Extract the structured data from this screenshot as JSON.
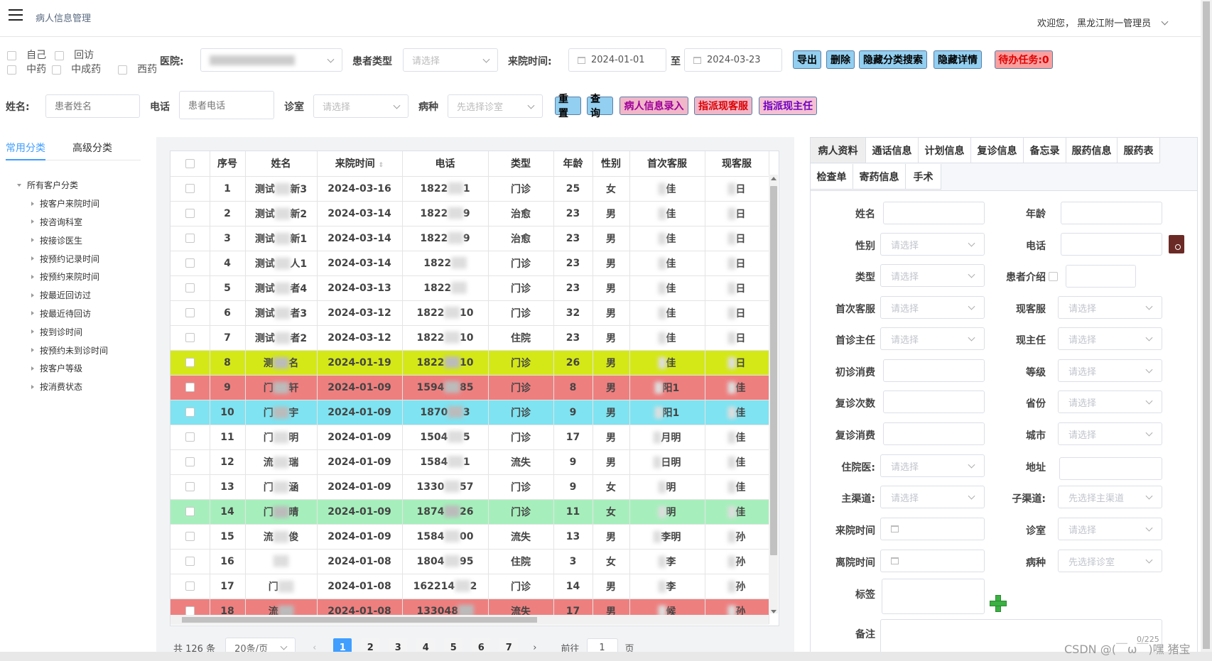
{
  "app": {
    "title": "病人信息管理",
    "welcome": "欢迎您， 黑龙江附一管理员"
  },
  "filters": {
    "checks": [
      "自己",
      "回访",
      "中药",
      "中成药",
      "西药"
    ],
    "hospital_label": "医院:",
    "patient_type_label": "患者类型",
    "patient_type_placeholder": "请选择",
    "visit_time_label": "来院时间:",
    "date_from": "2024-01-01",
    "date_to": "2024-03-23",
    "to_label": "至",
    "name_label": "姓名:",
    "name_placeholder": "患者姓名",
    "phone_label": "电话",
    "phone_placeholder": "患者电话",
    "room_label": "诊室",
    "room_placeholder": "请选择",
    "disease_label": "病种",
    "disease_placeholder": "先选择诊室"
  },
  "buttons": {
    "export": "导出",
    "delete": "删除",
    "hide_search": "隐藏分类搜索",
    "hide_detail": "隐藏详情",
    "todo": "待办任务:0",
    "reset": "重置",
    "query": "查询",
    "entry": "病人信息录入",
    "assign_service": "指派现客服",
    "assign_doctor": "指派现主任"
  },
  "sidebar": {
    "tab_common": "常用分类",
    "tab_advanced": "高级分类",
    "root": "所有客户分类",
    "items": [
      "按客户来院时间",
      "按咨询科室",
      "按接诊医生",
      "按预约记录时间",
      "按预约来院时间",
      "按最近回访过",
      "按最近待回访",
      "按到诊时间",
      "按预约未到诊时间",
      "按客户等级",
      "按消费状态"
    ]
  },
  "table": {
    "headers": [
      "序号",
      "姓名",
      "来院时间",
      "电话",
      "类型",
      "年龄",
      "性别",
      "首次客服",
      "现客服"
    ],
    "rows": [
      {
        "no": "1",
        "name": "测试",
        "name_m": "新3",
        "date": "2024-03-16",
        "phone": "1822",
        "phone_m": "1",
        "type": "门诊",
        "age": "25",
        "sex": "女",
        "first": "佳",
        "cur": "日",
        "color": ""
      },
      {
        "no": "2",
        "name": "测试",
        "name_m": "新2",
        "date": "2024-03-14",
        "phone": "1822",
        "phone_m": "9",
        "type": "治愈",
        "age": "23",
        "sex": "男",
        "first": "佳",
        "cur": "日",
        "color": ""
      },
      {
        "no": "3",
        "name": "测试",
        "name_m": "新1",
        "date": "2024-03-14",
        "phone": "1822",
        "phone_m": "9",
        "type": "治愈",
        "age": "23",
        "sex": "男",
        "first": "佳",
        "cur": "日",
        "color": ""
      },
      {
        "no": "4",
        "name": "测试",
        "name_m": "人1",
        "date": "2024-03-14",
        "phone": "1822",
        "phone_m": "",
        "type": "门诊",
        "age": "23",
        "sex": "男",
        "first": "佳",
        "cur": "日",
        "color": ""
      },
      {
        "no": "5",
        "name": "测试",
        "name_m": "者4",
        "date": "2024-03-13",
        "phone": "1822",
        "phone_m": "",
        "type": "门诊",
        "age": "23",
        "sex": "男",
        "first": "佳",
        "cur": "日",
        "color": ""
      },
      {
        "no": "6",
        "name": "测试",
        "name_m": "者3",
        "date": "2024-03-12",
        "phone": "1822",
        "phone_m": "10",
        "type": "门诊",
        "age": "32",
        "sex": "男",
        "first": "佳",
        "cur": "日",
        "color": ""
      },
      {
        "no": "7",
        "name": "测试",
        "name_m": "者2",
        "date": "2024-03-12",
        "phone": "1822",
        "phone_m": "10",
        "type": "住院",
        "age": "23",
        "sex": "男",
        "first": "佳",
        "cur": "日",
        "color": ""
      },
      {
        "no": "8",
        "name": "测",
        "name_m": "名",
        "date": "2024-01-19",
        "phone": "1822",
        "phone_m": "10",
        "type": "门诊",
        "age": "26",
        "sex": "男",
        "first": "佳",
        "cur": "日",
        "color": "#d4e817"
      },
      {
        "no": "9",
        "name": "门",
        "name_m": "轩",
        "date": "2024-01-09",
        "phone": "1594",
        "phone_m": "85",
        "type": "门诊",
        "age": "8",
        "sex": "男",
        "first": "阳1",
        "cur": "佳",
        "color": "#ee7f7f"
      },
      {
        "no": "10",
        "name": "门",
        "name_m": "宇",
        "date": "2024-01-09",
        "phone": "1870",
        "phone_m": "3",
        "type": "门诊",
        "age": "9",
        "sex": "男",
        "first": "阳1",
        "cur": "佳",
        "color": "#7fe3f1"
      },
      {
        "no": "11",
        "name": "门",
        "name_m": "明",
        "date": "2024-01-09",
        "phone": "1504",
        "phone_m": "5",
        "type": "门诊",
        "age": "17",
        "sex": "男",
        "first": "月明",
        "cur": "佳",
        "color": ""
      },
      {
        "no": "12",
        "name": "流",
        "name_m": "瑞",
        "date": "2024-01-09",
        "phone": "1584",
        "phone_m": "1",
        "type": "流失",
        "age": "9",
        "sex": "男",
        "first": "日明",
        "cur": "佳",
        "color": ""
      },
      {
        "no": "13",
        "name": "门",
        "name_m": "涵",
        "date": "2024-01-09",
        "phone": "1330",
        "phone_m": "57",
        "type": "门诊",
        "age": "9",
        "sex": "女",
        "first": "明",
        "cur": "佳",
        "color": ""
      },
      {
        "no": "14",
        "name": "门",
        "name_m": "晴",
        "date": "2024-01-09",
        "phone": "1874",
        "phone_m": "26",
        "type": "门诊",
        "age": "11",
        "sex": "女",
        "first": "明",
        "cur": "佳",
        "color": "#a6efbc"
      },
      {
        "no": "15",
        "name": "流",
        "name_m": "俊",
        "date": "2024-01-09",
        "phone": "1584",
        "phone_m": "00",
        "type": "流失",
        "age": "13",
        "sex": "男",
        "first": "李明",
        "cur": "孙",
        "color": ""
      },
      {
        "no": "16",
        "name": "",
        "name_m": "",
        "date": "2024-01-08",
        "phone": "1804",
        "phone_m": "95",
        "type": "住院",
        "age": "3",
        "sex": "女",
        "first": "李",
        "cur": "孙",
        "color": ""
      },
      {
        "no": "17",
        "name": "门",
        "name_m": "",
        "date": "2024-01-08",
        "phone": "162214",
        "phone_m": "2",
        "type": "门诊",
        "age": "14",
        "sex": "男",
        "first": "李",
        "cur": "孙",
        "color": ""
      },
      {
        "no": "18",
        "name": "流",
        "name_m": "",
        "date": "2024-01-08",
        "phone": "133048",
        "phone_m": "",
        "type": "流失",
        "age": "17",
        "sex": "男",
        "first": "候",
        "cur": "孙",
        "color": "#ee7f7f"
      }
    ]
  },
  "pagination": {
    "total": "共 126 条",
    "page_size": "20条/页",
    "pages": [
      "1",
      "2",
      "3",
      "4",
      "5",
      "6",
      "7"
    ],
    "goto": "前往",
    "goto_value": "1",
    "page_unit": "页"
  },
  "detail": {
    "tabs_row1": [
      "病人资料",
      "通话信息",
      "计划信息",
      "复诊信息",
      "备忘录",
      "服药信息",
      "服药表"
    ],
    "tabs_row2": [
      "检查单",
      "寄药信息",
      "手术"
    ],
    "fields": {
      "name": "姓名",
      "age": "年龄",
      "sex": "性别",
      "phone": "电话",
      "type": "类型",
      "intro": "患者介绍",
      "first_service": "首次客服",
      "cur_service": "现客服",
      "first_doctor": "首诊主任",
      "cur_doctor": "现主任",
      "first_cost": "初诊消费",
      "level": "等级",
      "revisit_count": "复诊次数",
      "province": "省份",
      "revisit_cost": "复诊消费",
      "city": "城市",
      "inpatient_doc": "住院医:",
      "address": "地址",
      "main_channel": "主渠道:",
      "sub_channel": "子渠道:",
      "visit_time": "来院时间",
      "room": "诊室",
      "leave_time": "离院时间",
      "disease": "病种",
      "tags": "标签",
      "note": "备注"
    },
    "placeholder": "请选择",
    "sub_channel_placeholder": "先选择主渠道",
    "disease_placeholder": "先选择诊室",
    "note_count": "0/225"
  },
  "watermark": "CSDN @(￣ω￣)嘿 猪宝"
}
